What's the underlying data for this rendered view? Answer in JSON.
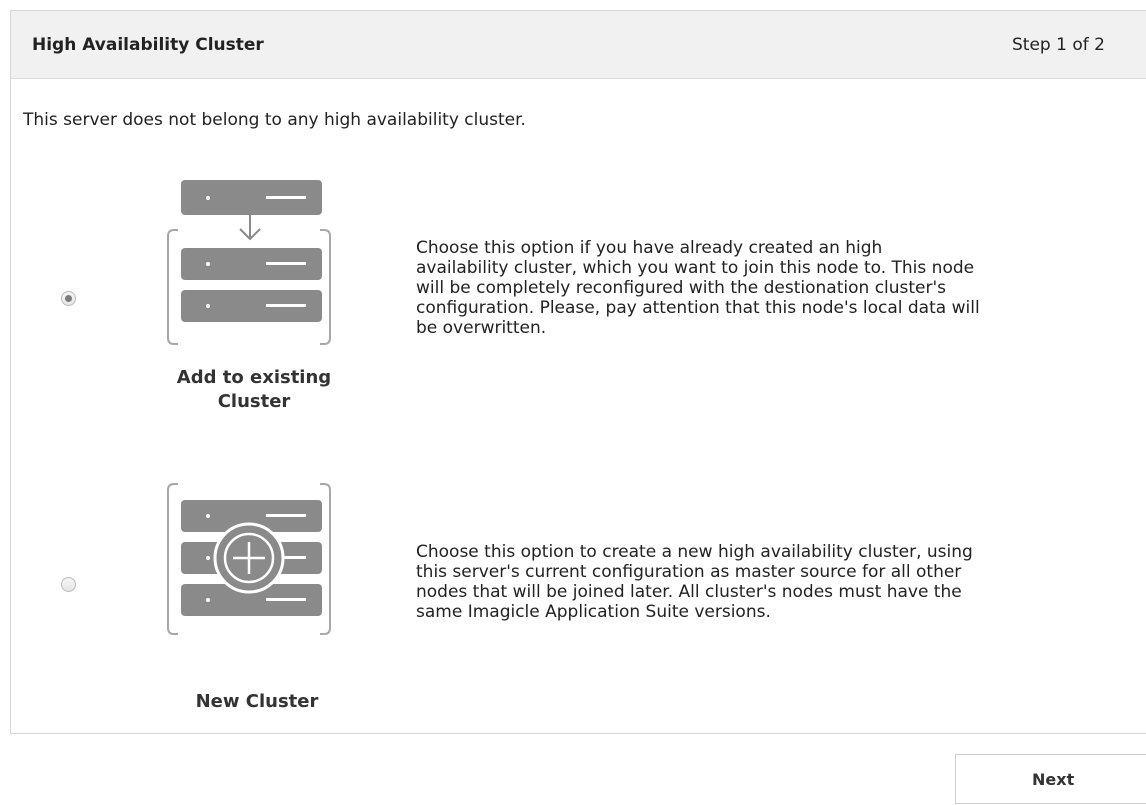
{
  "header": {
    "title": "High Availability Cluster",
    "step": "Step 1 of 2"
  },
  "intro_text": "This server does not belong to any high availability cluster.",
  "options": [
    {
      "title_line1": "Add to existing",
      "title_line2": "Cluster",
      "selected": true,
      "icon": "server-join-icon",
      "description": [
        "Choose this option if you have already created an high",
        "availability cluster, which you want to join this node to. This node",
        "will be completely reconfigured with the destionation cluster's",
        "configuration. Please, pay attention that this node's local data will",
        "be overwritten."
      ]
    },
    {
      "title_line1": "New Cluster",
      "selected": false,
      "icon": "server-add-icon",
      "description": [
        "Choose this option to create a new high availability cluster, using",
        "this server's current configuration as master source for all other",
        "nodes that will be joined later. All cluster's nodes must have the",
        "same Imagicle Application Suite versions."
      ]
    }
  ],
  "buttons": {
    "next_label": "Next"
  },
  "colors": {
    "icon_gray": "#8a8a8a",
    "bracket_gray": "#a8a8a8",
    "header_bg": "#f1f1f1"
  }
}
